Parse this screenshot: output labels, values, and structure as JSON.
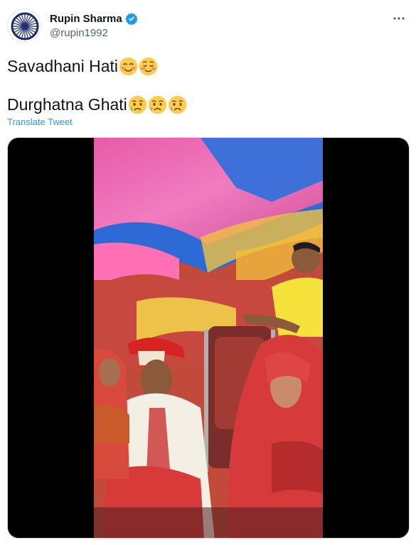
{
  "tweet": {
    "author": {
      "display_name": "Rupin Sharma",
      "handle": "@rupin1992",
      "verified": true,
      "avatar_icon": "ashoka-chakra-icon"
    },
    "text_lines": [
      "Savadhani Hati",
      "Durghatna Ghati"
    ],
    "line1_emojis": [
      "smiling-face-with-smiling-eyes",
      "smiling-face-with-blush"
    ],
    "line2_emojis": [
      "crying-face",
      "crying-face",
      "crying-face"
    ],
    "translate_label": "Translate Tweet",
    "more_icon": "more-horizontal-icon"
  },
  "media": {
    "type": "video",
    "description_colors": {
      "accent": "#1d9bf0",
      "text": "#0f1419",
      "muted": "#536471"
    }
  }
}
